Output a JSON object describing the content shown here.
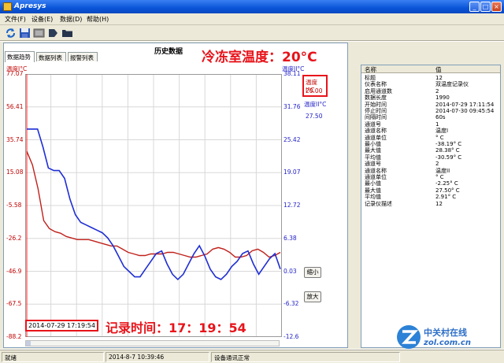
{
  "window": {
    "title": "Apresys"
  },
  "menu": [
    "文件(F)",
    "设备(E)",
    "数据(D)",
    "帮助(H)"
  ],
  "panel": {
    "tabs": [
      "数据趋势",
      "数据列表",
      "报警列表"
    ],
    "title": "历史数据"
  },
  "annotations": {
    "temp": "冷冻室温度：20°C",
    "time": "记录时间：17：19：54"
  },
  "readout": {
    "label": "温度I°C",
    "value": "20.00",
    "label2": "温度II°C",
    "value2": "27.50"
  },
  "time_display": "2014-07-29 17:19:54",
  "buttons": {
    "zoom_out": "缩小",
    "zoom_in": "放大"
  },
  "properties": {
    "header": {
      "name": "名称",
      "value": "值"
    },
    "rows": [
      [
        "标题",
        "12"
      ],
      [
        "仪表名称",
        "双温度记录仪"
      ],
      [
        "启用通道数",
        "2"
      ],
      [
        "数据长度",
        "1990"
      ],
      [
        "开始时间",
        "2014-07-29 17:11:54"
      ],
      [
        "停止时间",
        "2014-07-30 09:45:54"
      ],
      [
        "间隔时间",
        "60s"
      ],
      [
        "通道号",
        "1"
      ],
      [
        "通道名称",
        "温度I"
      ],
      [
        "通道单位",
        "° C"
      ],
      [
        "最小值",
        "-38.19° C"
      ],
      [
        "最大值",
        "28.38° C"
      ],
      [
        "平均值",
        "-30.59° C"
      ],
      [
        "通道号",
        "2"
      ],
      [
        "通道名称",
        "温度II"
      ],
      [
        "通道单位",
        "° C"
      ],
      [
        "最小值",
        "-2.25° C"
      ],
      [
        "最大值",
        "27.50° C"
      ],
      [
        "平均值",
        "2.91° C"
      ],
      [
        "记录仪描述",
        "12"
      ]
    ]
  },
  "status": {
    "ready": "就绪",
    "datetime": "2014-8-7 10:39:46",
    "message": "设备通讯正常"
  },
  "watermark": {
    "text": "中关村在线",
    "url": "zol.com.cn"
  },
  "colors": {
    "series1": "#c0201a",
    "series2": "#1f2ed4",
    "annotation": "#e8131a"
  },
  "chart_data": {
    "type": "line",
    "y_left_label": "温度I°C",
    "y_right_label": "温度II°C",
    "y_left_ticks": [
      "77.07",
      "56.41",
      "35.74",
      "15.08",
      "-5.58",
      "-26.2",
      "-46.9",
      "-67.5",
      "-88.2"
    ],
    "y_right_ticks": [
      "38.11",
      "31.76",
      "25.42",
      "19.07",
      "12.72",
      "6.38",
      "0.03",
      "-6.32",
      "-12.6"
    ],
    "ylim_left": [
      -88.2,
      77.07
    ],
    "ylim_right": [
      -12.6,
      38.11
    ],
    "series": [
      {
        "name": "温度I",
        "axis": "left",
        "values": [
          28.5,
          20,
          5,
          -15,
          -20,
          -22,
          -23,
          -25,
          -26,
          -27,
          -27,
          -27,
          -28,
          -29,
          -30,
          -31,
          -31,
          -33,
          -35,
          -36,
          -37,
          -37,
          -36,
          -36,
          -36,
          -35,
          -35,
          -36,
          -37,
          -38,
          -38,
          -37,
          -36,
          -33,
          -32,
          -33,
          -35,
          -38,
          -38,
          -37,
          -34,
          -33,
          -35,
          -38,
          -37,
          -35
        ]
      },
      {
        "name": "温度II",
        "axis": "right",
        "values": [
          27.5,
          27.5,
          27.5,
          24,
          20,
          19.5,
          19.5,
          18,
          14,
          11,
          9.5,
          9,
          8.5,
          8,
          7.5,
          6.5,
          5,
          3,
          1,
          0,
          -1,
          -1,
          0.5,
          2,
          3.5,
          4,
          1.5,
          -0.5,
          -1.5,
          -0.5,
          1.5,
          3.5,
          5,
          3,
          0.5,
          -1,
          -1.5,
          -0.5,
          1,
          2,
          3.5,
          4,
          1.5,
          -0.5,
          1,
          2.5,
          3.5,
          0.5
        ]
      }
    ]
  }
}
